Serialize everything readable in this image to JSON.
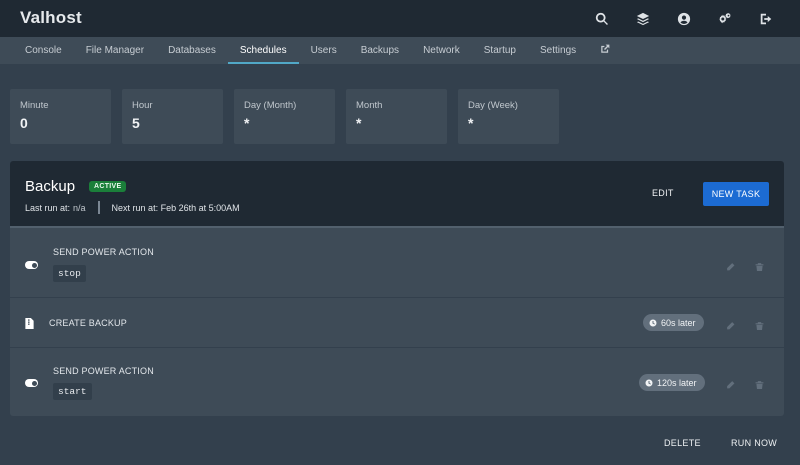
{
  "app": {
    "title": "Valhost"
  },
  "top_icons": [
    "search-icon",
    "layers-icon",
    "account-icon",
    "cogs-icon",
    "sign-out-icon"
  ],
  "tabs": [
    {
      "label": "Console"
    },
    {
      "label": "File Manager"
    },
    {
      "label": "Databases"
    },
    {
      "label": "Schedules",
      "active": true
    },
    {
      "label": "Users"
    },
    {
      "label": "Backups"
    },
    {
      "label": "Network"
    },
    {
      "label": "Startup"
    },
    {
      "label": "Settings"
    }
  ],
  "cron": [
    {
      "label": "Minute",
      "value": "0"
    },
    {
      "label": "Hour",
      "value": "5"
    },
    {
      "label": "Day (Month)",
      "value": "*"
    },
    {
      "label": "Month",
      "value": "*"
    },
    {
      "label": "Day (Week)",
      "value": "*"
    }
  ],
  "schedule": {
    "name": "Backup",
    "status": "ACTIVE",
    "last_run_label": "Last run at:",
    "last_run_value": "n/a",
    "next_run": "Next run at: Feb 26th at 5:00AM",
    "edit_label": "EDIT",
    "new_task_label": "NEW TASK"
  },
  "tasks": [
    {
      "title": "SEND POWER ACTION",
      "payload": "stop",
      "icon": "toggle-icon"
    },
    {
      "title": "CREATE BACKUP",
      "delay": "60s later",
      "icon": "file-archive-icon"
    },
    {
      "title": "SEND POWER ACTION",
      "payload": "start",
      "delay": "120s later",
      "icon": "toggle-icon"
    }
  ],
  "footer": {
    "delete_label": "DELETE",
    "run_now_label": "RUN NOW"
  },
  "colors": {
    "accent": "#1c6bd3",
    "active_badge": "#1b7f3a",
    "tab_underline": "#51a8c7"
  }
}
